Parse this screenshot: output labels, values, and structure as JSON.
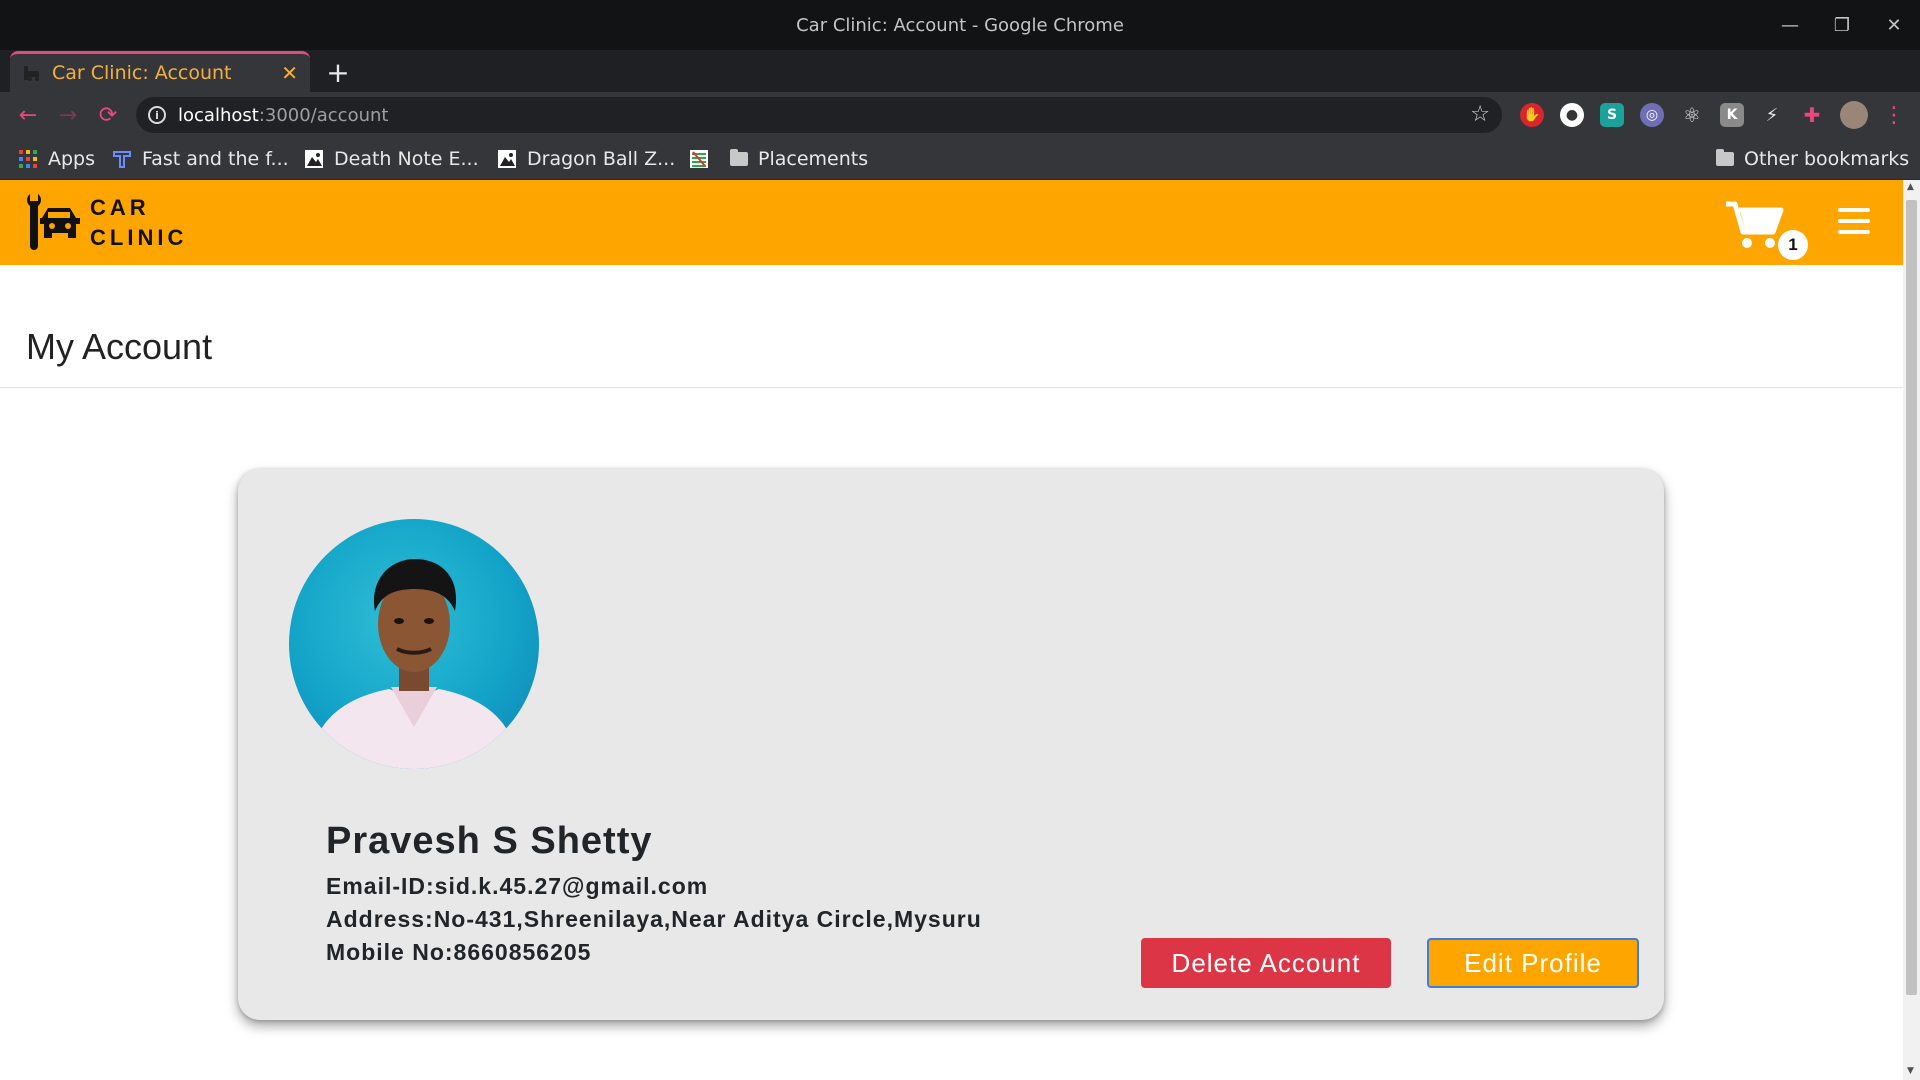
{
  "window": {
    "title": "Car Clinic: Account - Google Chrome",
    "controls": {
      "minimize": "—",
      "restore": "❐",
      "close": "✕"
    }
  },
  "tab": {
    "title": "Car Clinic: Account",
    "close": "✕",
    "new_tab": "+"
  },
  "toolbar": {
    "url_host": "localhost",
    "url_path": ":3000/account",
    "back": "←",
    "forward": "→",
    "reload": "⟳",
    "star": "☆",
    "menu": "⋮",
    "extensions": [
      "adblock-icon",
      "circle-extension-icon",
      "s-extension-icon",
      "tube-extension-icon",
      "react-devtools-icon",
      "k-extension-icon",
      "plug-extension-icon",
      "puzzle-extensions-icon",
      "profile-avatar-icon"
    ]
  },
  "bookmarks": {
    "items": [
      {
        "label": "Apps",
        "icon": "apps-grid-icon"
      },
      {
        "label": "Fast and the f...",
        "icon": "t-bookmark-icon"
      },
      {
        "label": "Death Note E...",
        "icon": "anime-bookmark-icon"
      },
      {
        "label": "Dragon Ball Z...",
        "icon": "anime-bookmark-icon"
      },
      {
        "label": "",
        "icon": "striped-bookmark-icon"
      },
      {
        "label": "Placements",
        "icon": "folder-icon"
      }
    ],
    "other": "Other bookmarks"
  },
  "site": {
    "logo_line1": "CAR",
    "logo_line2": "CLINIC",
    "cart_count": "1",
    "brand_color": "#ffa500"
  },
  "page": {
    "title": "My Account"
  },
  "profile": {
    "name": "Pravesh S Shetty",
    "email": "Email-ID:sid.k.45.27@gmail.com",
    "address": "Address:No-431,Shreenilaya,Near Aditya Circle,Mysuru",
    "mobile": "Mobile No:8660856205"
  },
  "actions": {
    "delete": "Delete Account",
    "edit": "Edit Profile"
  }
}
